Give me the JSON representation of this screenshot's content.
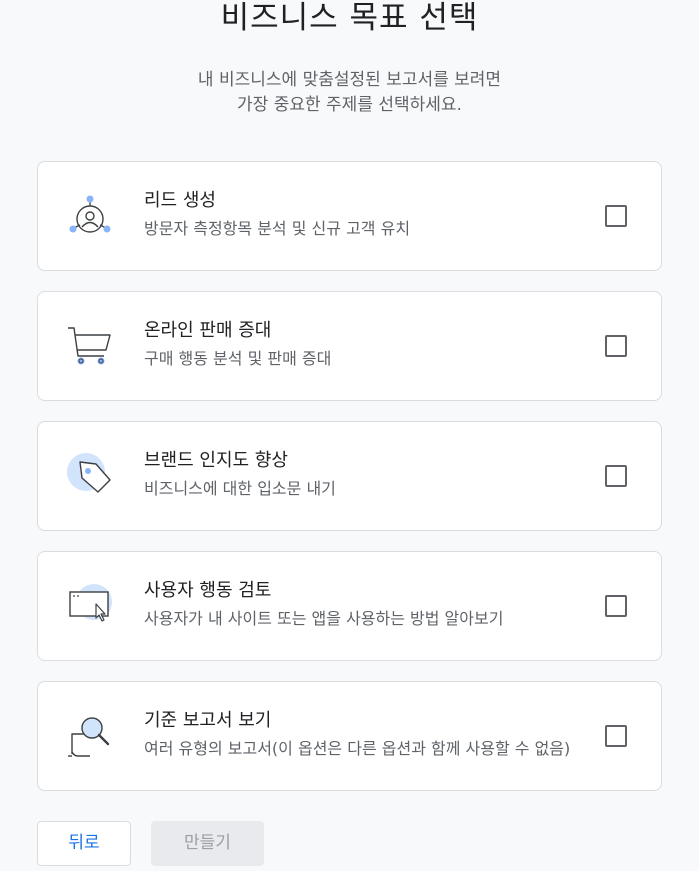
{
  "header": {
    "title": "비즈니스 목표 선택",
    "subtitle_line1": "내 비즈니스에 맞춤설정된 보고서를 보려면",
    "subtitle_line2": "가장 중요한 주제를 선택하세요."
  },
  "options": [
    {
      "title": "리드 생성",
      "description": "방문자 측정항목 분석 및 신규 고객 유치",
      "icon": "lead-generation-icon",
      "checked": false
    },
    {
      "title": "온라인 판매 증대",
      "description": "구매 행동 분석 및 판매 증대",
      "icon": "shopping-cart-icon",
      "checked": false
    },
    {
      "title": "브랜드 인지도 향상",
      "description": "비즈니스에 대한 입소문 내기",
      "icon": "tag-icon",
      "checked": false
    },
    {
      "title": "사용자 행동 검토",
      "description": "사용자가 내 사이트 또는 앱을 사용하는 방법 알아보기",
      "icon": "browser-cursor-icon",
      "checked": false
    },
    {
      "title": "기준 보고서 보기",
      "description": "여러 유형의 보고서(이 옵션은 다른 옵션과 함께 사용할 수 없음)",
      "icon": "magnifier-report-icon",
      "checked": false
    }
  ],
  "footer": {
    "back_label": "뒤로",
    "create_label": "만들기"
  },
  "colors": {
    "accent": "#1a73e8",
    "icon_fill": "#d2e3fc",
    "icon_stroke": "#3c4043",
    "icon_accent": "#8ab4f8",
    "border": "#dadce0",
    "disabled_bg": "#e8eaed",
    "disabled_text": "#9aa0a6"
  }
}
